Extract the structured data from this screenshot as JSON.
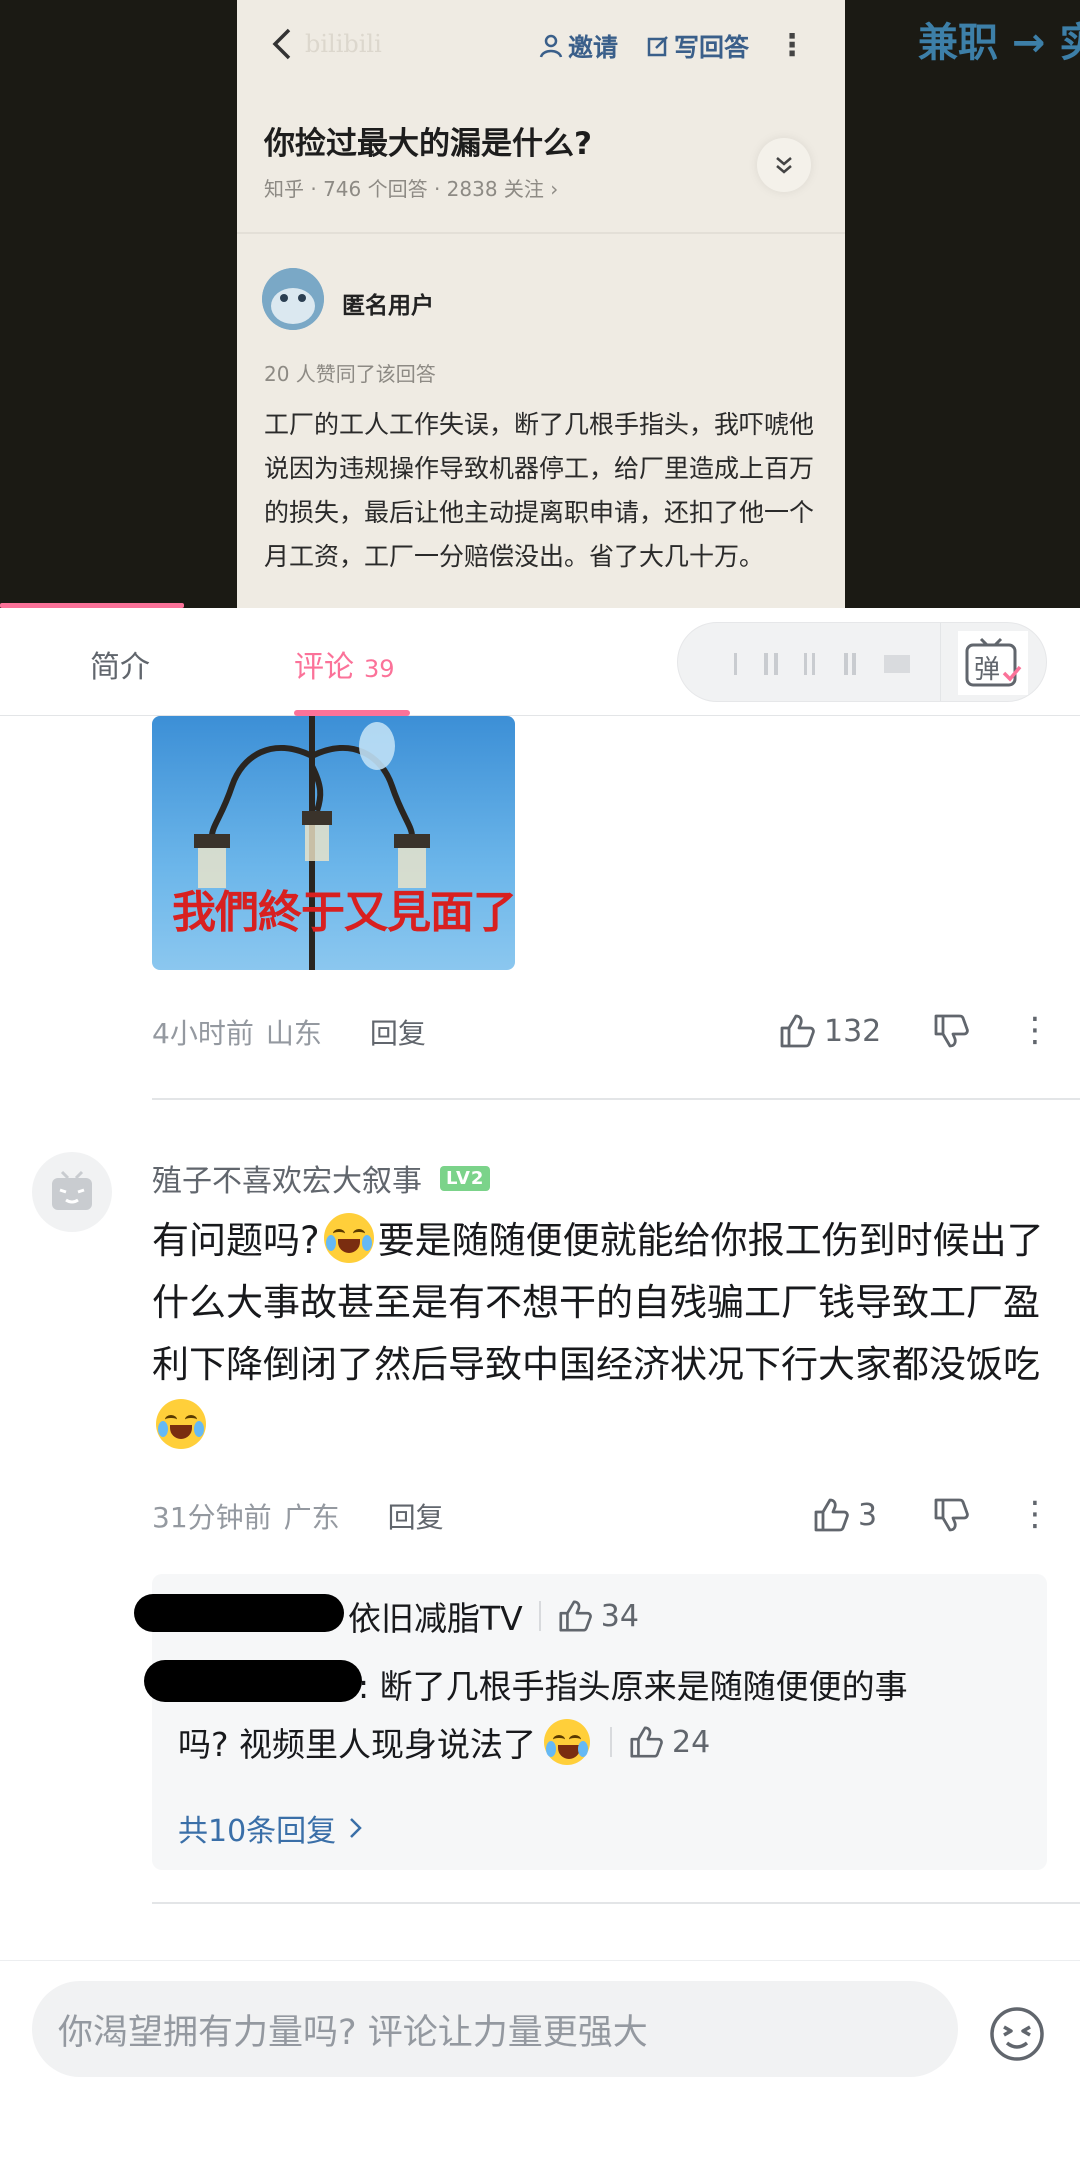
{
  "video": {
    "watermark": "bilibili",
    "invite_label": "邀请",
    "write_answer_label": "写回答",
    "question_title": "你捡过最大的漏是什么?",
    "question_meta": "知乎 · 746 个回答 · 2838 关注 ›",
    "answer_user": "匿名用户",
    "answer_likes": "20 人赞同了该回答",
    "answer_body": "工厂的工人工作失误，断了几根手指头，我吓唬他说因为违规操作导致机器停工，给厂里造成上百万的损失，最后让他主动提离职申请，还扣了他一个月工资，工厂一分赔偿没出。省了大几十万。",
    "side_text": "兼职 → 实",
    "progress_fraction": 0.17
  },
  "tabs": {
    "intro_label": "简介",
    "comments_label": "评论",
    "comments_count": "39",
    "danmaku_toggle_label": "弹"
  },
  "meme": {
    "caption": "我們終于又見面了"
  },
  "comment1": {
    "time": "4小时前",
    "location": "山东",
    "reply_label": "回复",
    "likes": "132"
  },
  "comment2": {
    "username": "殖子不喜欢宏大叙事",
    "level": "LV2",
    "text_part1": "有问题吗?",
    "text_part2": "要是随随便便就能给你报工伤到时候出了什么大事故甚至是有不想干的自残骗工厂钱导致工厂盈利下降倒闭了然后导致中国经济状况下行大家都没饭吃",
    "time": "31分钟前",
    "location": "广东",
    "reply_label": "回复",
    "likes": "3",
    "replies": [
      {
        "author_suffix": "依旧减脂TV",
        "likes": "34"
      },
      {
        "text_line1": ": 断了几根手指头原来是随随便便的事",
        "text_line2": "吗? 视频里人现身说法了",
        "likes": "24"
      }
    ],
    "more_replies": "共10条回复"
  },
  "bottom": {
    "input_placeholder": "你渴望拥有力量吗? 评论让力量更强大"
  },
  "colors": {
    "accent": "#fb7299",
    "link": "#3a6fa8",
    "level_badge": "#7bd38a"
  }
}
